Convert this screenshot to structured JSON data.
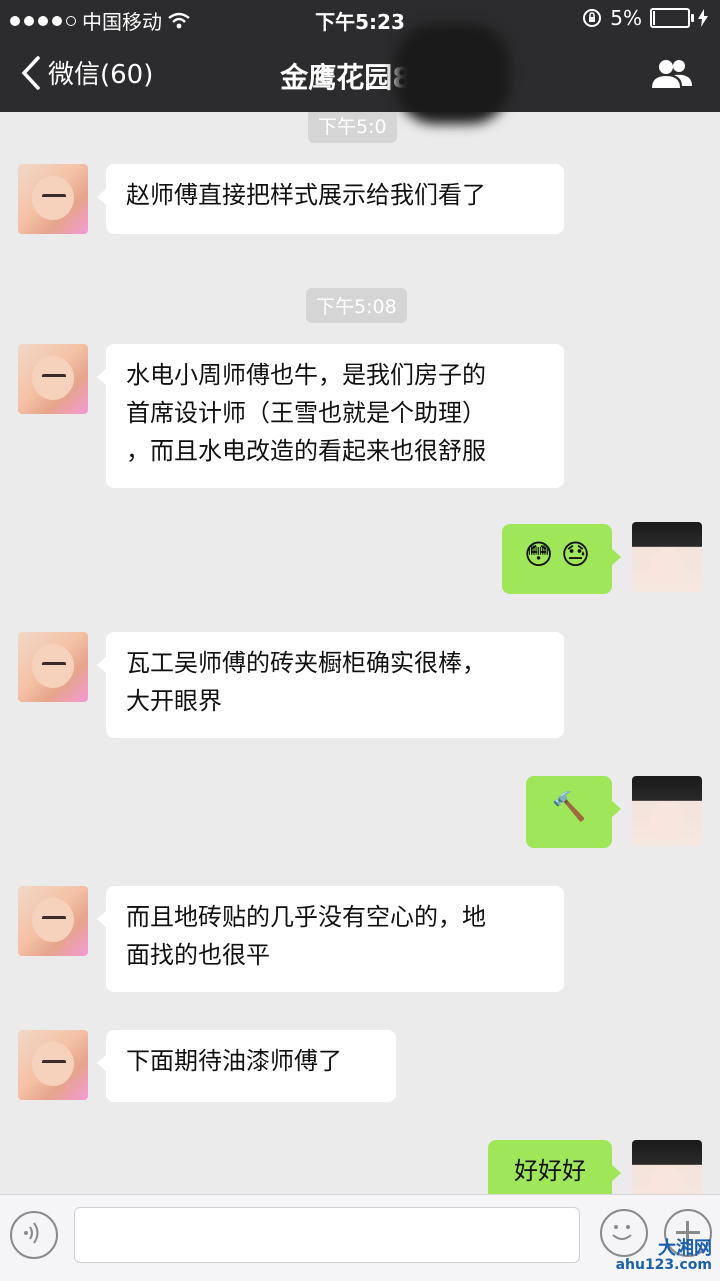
{
  "status_bar": {
    "carrier": "中国移动",
    "time": "下午5:23",
    "battery_text": "5%",
    "battery_level": 0.05
  },
  "nav": {
    "back_label": "微信(60)",
    "title": "金鹰花园8栋"
  },
  "messages": [
    {
      "type": "time",
      "text": "下午5:0"
    },
    {
      "type": "text",
      "side": "left",
      "lines": [
        "赵师傅直接把样式展示给我们看了"
      ]
    },
    {
      "type": "time",
      "text": "下午5:08"
    },
    {
      "type": "text",
      "side": "left",
      "lines": [
        "水电小周师傅也牛，是我们房子的",
        "首席设计师（王雪也就是个助理）",
        "，而且水电改造的看起来也很舒服"
      ]
    },
    {
      "type": "emoji",
      "side": "right",
      "emojis": [
        "😳",
        "😓"
      ]
    },
    {
      "type": "text",
      "side": "left",
      "lines": [
        "瓦工吴师傅的砖夹橱柜确实很棒，",
        "大开眼界"
      ]
    },
    {
      "type": "emoji",
      "side": "right",
      "emojis": [
        "🔨"
      ]
    },
    {
      "type": "text",
      "side": "left",
      "lines": [
        "而且地砖贴的几乎没有空心的，地",
        "面找的也很平"
      ]
    },
    {
      "type": "text",
      "side": "left",
      "lines": [
        "下面期待油漆师傅了"
      ]
    },
    {
      "type": "text",
      "side": "right",
      "lines": [
        "好好好"
      ]
    }
  ],
  "watermark": {
    "name": "大湘网",
    "url": "ahu123.com"
  },
  "colors": {
    "nav_bg": "#2c2c2e",
    "chat_bg": "#ebebeb",
    "my_bubble": "#9fe658",
    "other_bubble": "#ffffff"
  }
}
